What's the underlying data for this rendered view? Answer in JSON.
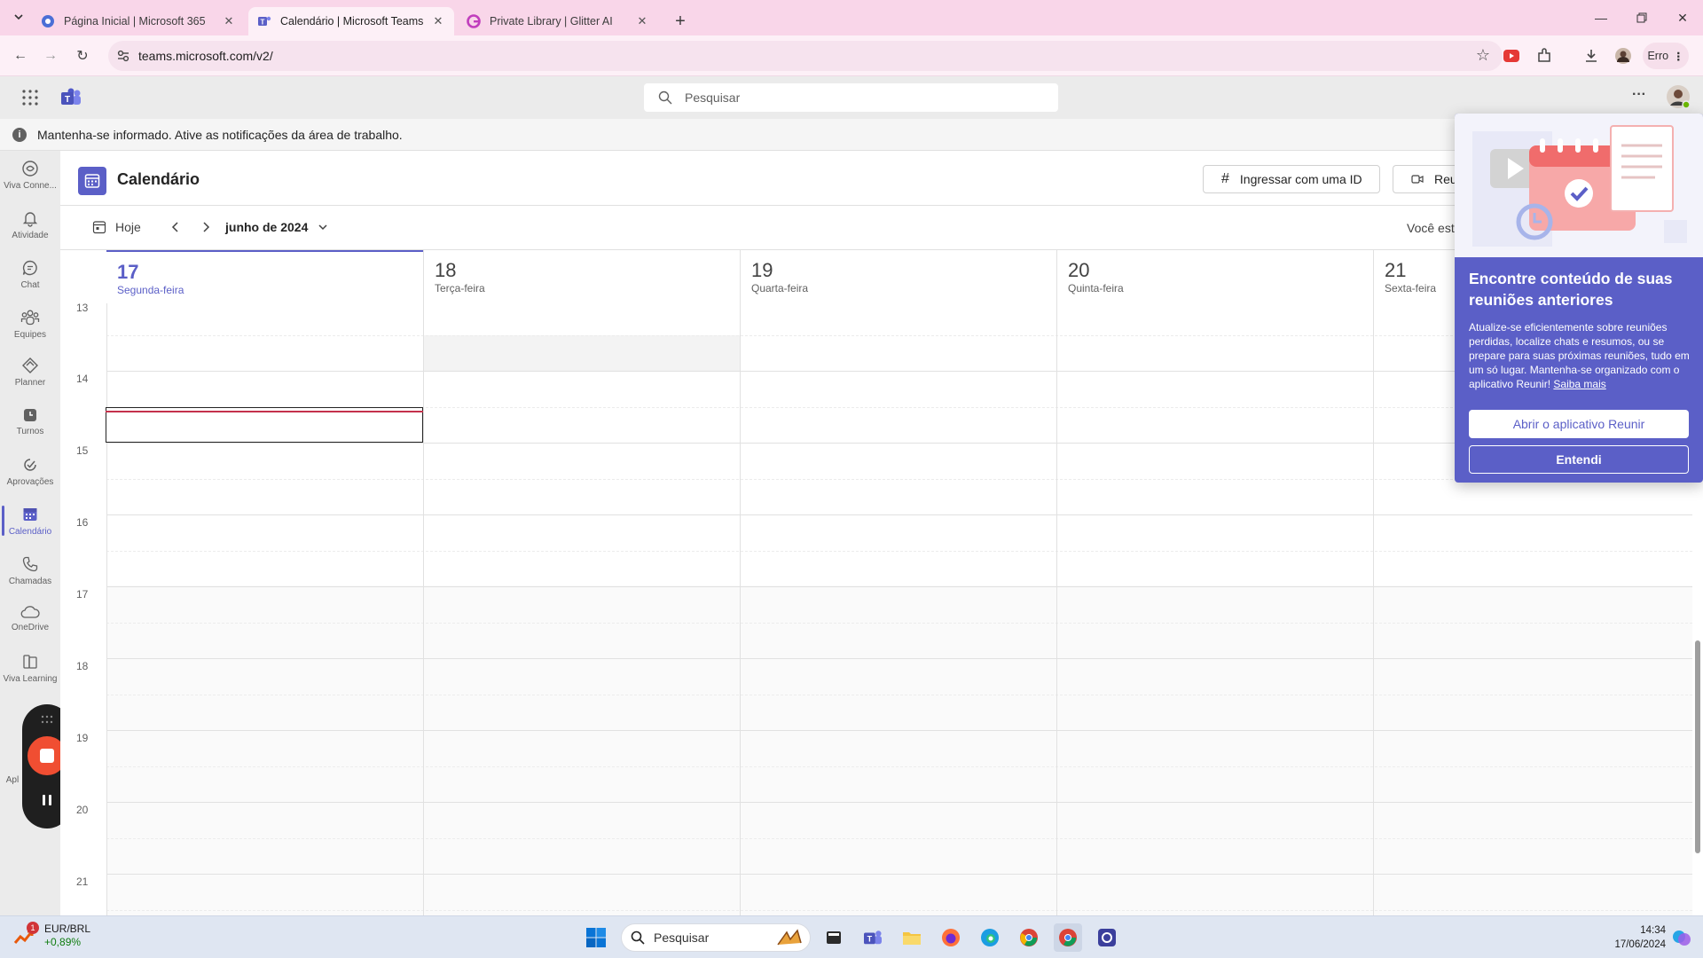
{
  "browser": {
    "tabs": [
      {
        "title": "Página Inicial | Microsoft 365",
        "icon": "m365-icon",
        "active": false
      },
      {
        "title": "Calendário | Microsoft Teams",
        "icon": "teams-icon",
        "active": true
      },
      {
        "title": "Private Library | Glitter AI",
        "icon": "glitter-icon",
        "active": false
      }
    ],
    "url": "teams.microsoft.com/v2/",
    "profile_label": "Erro"
  },
  "teams": {
    "search_placeholder": "Pesquisar",
    "notice": "Mantenha-se informado. Ative as notificações da área de trabalho.",
    "rail": [
      {
        "label": "Viva Conne...",
        "icon": "viva-connections-icon"
      },
      {
        "label": "Atividade",
        "icon": "bell-icon"
      },
      {
        "label": "Chat",
        "icon": "chat-icon"
      },
      {
        "label": "Equipes",
        "icon": "teams-people-icon"
      },
      {
        "label": "Planner",
        "icon": "planner-icon"
      },
      {
        "label": "Turnos",
        "icon": "shifts-icon"
      },
      {
        "label": "Aprovações",
        "icon": "approvals-icon"
      },
      {
        "label": "Calendário",
        "icon": "calendar-icon",
        "active": true
      },
      {
        "label": "Chamadas",
        "icon": "phone-icon"
      },
      {
        "label": "OneDrive",
        "icon": "cloud-icon"
      },
      {
        "label": "Viva Learning",
        "icon": "learning-icon"
      },
      {
        "label": "Apl",
        "icon": "apps-icon"
      }
    ]
  },
  "calendar": {
    "title": "Calendário",
    "join_id_label": "Ingressar com uma ID",
    "meet_label": "Reu",
    "today_label": "Hoje",
    "month_label": "junho de 2024",
    "you_are_label": "Você está",
    "days": [
      {
        "num": "17",
        "name": "Segunda-feira",
        "today": true
      },
      {
        "num": "18",
        "name": "Terça-feira"
      },
      {
        "num": "19",
        "name": "Quarta-feira"
      },
      {
        "num": "20",
        "name": "Quinta-feira"
      },
      {
        "num": "21",
        "name": "Sexta-feira"
      }
    ],
    "hours": [
      "13",
      "14",
      "15",
      "16",
      "17",
      "18",
      "19",
      "20",
      "21"
    ]
  },
  "popover": {
    "title": "Encontre conteúdo de suas reuniões anteriores",
    "body": "Atualize-se eficientemente sobre reuniões perdidas, localize chats e resumos, ou se prepare para suas próximas reuniões, tudo em um só lugar. Mantenha-se organizado com o aplicativo Reunir!",
    "link": "Saiba mais",
    "primary_button": "Abrir o aplicativo Reunir",
    "secondary_button": "Entendi"
  },
  "taskbar": {
    "widget_title": "EUR/BRL",
    "widget_value": "+0,89%",
    "widget_badge": "1",
    "search_label": "Pesquisar",
    "time": "14:34",
    "date": "17/06/2024"
  },
  "colors": {
    "accent": "#5b5fc7",
    "tabstrip": "#f9d6e9",
    "current_time_line": "#c4314b"
  }
}
